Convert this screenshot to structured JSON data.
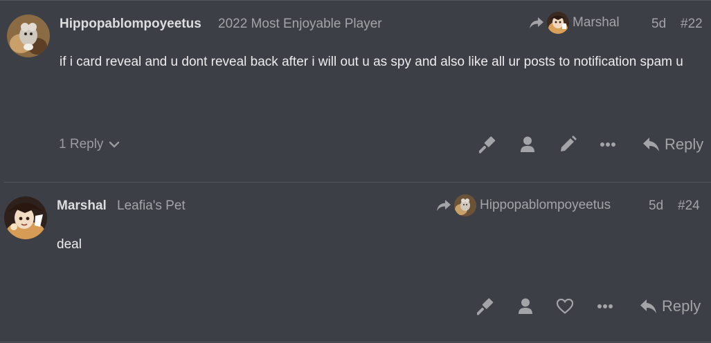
{
  "posts": [
    {
      "username": "Hippopablompoyeetus",
      "user_title": "2022 Most Enjoyable Player",
      "reply_to_name": "Marshal",
      "age": "5d",
      "post_number": "#22",
      "body": "if i card reveal and u dont reveal back after i will out u as spy and also like all ur posts to notification spam u",
      "replies_label": "1 Reply",
      "reply_label": "Reply",
      "actions": [
        "gavel-icon",
        "user-icon",
        "pencil-icon",
        "more-icon"
      ]
    },
    {
      "username": "Marshal",
      "user_title": "Leafia's Pet",
      "reply_to_name": "Hippopablompoyeetus",
      "age": "5d",
      "post_number": "#24",
      "body": "deal",
      "reply_label": "Reply",
      "actions": [
        "gavel-icon",
        "user-icon",
        "heart-icon",
        "more-icon"
      ]
    }
  ],
  "colors": {
    "background": "#3d3f46",
    "divider": "#55575e",
    "text": "#dcdddf",
    "muted": "#a3a4a8"
  }
}
